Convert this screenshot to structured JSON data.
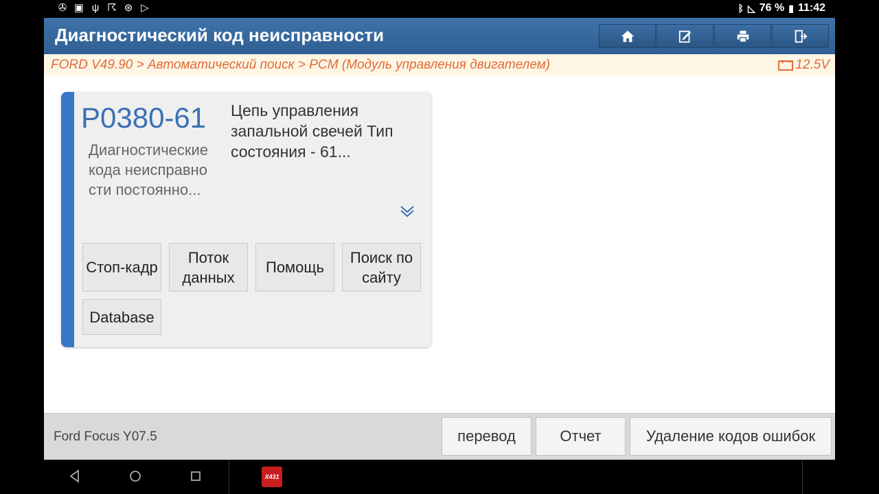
{
  "status_bar": {
    "battery": "76 %",
    "time": "11:42",
    "left_icons": [
      "fan-icon",
      "image-icon",
      "usb-icon",
      "person-icon",
      "bluetooth-settings-icon",
      "play-store-icon"
    ],
    "right_icons": [
      "bluetooth-icon",
      "no-signal-icon",
      "battery-icon"
    ]
  },
  "header": {
    "title": "Диагностический код неисправности",
    "buttons": [
      "home-icon",
      "edit-icon",
      "print-icon",
      "exit-icon"
    ]
  },
  "breadcrumb": {
    "path": "FORD V49.90 > Автоматический поиск > PCM (Модуль управления двигателем)",
    "voltage": "12.5V"
  },
  "dtc": {
    "code": "P0380-61",
    "status": "Диагностические кода неисправности постоянно...",
    "description": "Цепь управления запальной свечей Тип состояния  - 61...",
    "buttons": {
      "freeze_frame": "Стоп-кадр",
      "data_stream": "Поток данных",
      "help": "Помощь",
      "site_search": "Поиск по сайту",
      "database": "Database"
    }
  },
  "footer": {
    "vehicle": "Ford Focus Y07.5",
    "translate": "перевод",
    "report": "Отчет",
    "clear_codes": "Удаление кодов ошибок"
  },
  "colors": {
    "header_blue": "#3f73a9",
    "breadcrumb_orange": "#e26a3a",
    "dtc_code_blue": "#3a70b4",
    "card_accent": "#3977c8",
    "app_icon_red": "#c81e1e"
  },
  "navbar": {
    "app_icon_label": "X431",
    "icons": [
      "back-icon",
      "home-circle-icon",
      "recents-icon"
    ]
  }
}
